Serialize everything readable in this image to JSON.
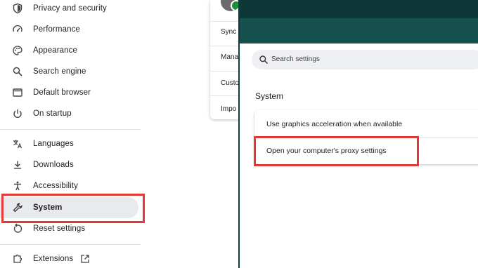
{
  "sidebar": {
    "items": [
      {
        "label": "Privacy and security",
        "icon": "shield-icon"
      },
      {
        "label": "Performance",
        "icon": "speedometer-icon"
      },
      {
        "label": "Appearance",
        "icon": "palette-icon"
      },
      {
        "label": "Search engine",
        "icon": "search-icon"
      },
      {
        "label": "Default browser",
        "icon": "browser-window-icon"
      },
      {
        "label": "On startup",
        "icon": "power-icon"
      },
      {
        "label": "Languages",
        "icon": "translate-icon"
      },
      {
        "label": "Downloads",
        "icon": "download-icon"
      },
      {
        "label": "Accessibility",
        "icon": "accessibility-icon"
      },
      {
        "label": "System",
        "icon": "wrench-icon",
        "active": true
      },
      {
        "label": "Reset settings",
        "icon": "reset-icon"
      },
      {
        "label": "Extensions",
        "icon": "puzzle-icon"
      }
    ],
    "external_link_icon": "external-link-icon"
  },
  "profile_menu": {
    "items": [
      "Sync",
      "Mana",
      "Custo",
      "Impo"
    ]
  },
  "main": {
    "search_placeholder": "Search settings",
    "section_title": "System",
    "settings": [
      "Use graphics acceleration when available",
      "Open your computer's proxy settings"
    ]
  },
  "colors": {
    "highlight": "#e53935",
    "header_dark": "#0d3837",
    "header_teal": "#15504e",
    "active_bg": "#e8eaed"
  }
}
